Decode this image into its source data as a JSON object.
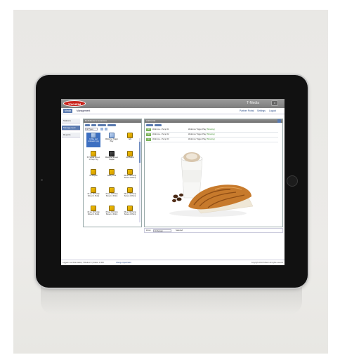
{
  "app": {
    "logo_text": "TOKHEIM",
    "title": "T-Media",
    "header_button": "×"
  },
  "nav": {
    "tabs": [
      "Media",
      "Management"
    ],
    "right_links": [
      "Partner Portal",
      "Settings",
      "Logout"
    ]
  },
  "left_menu": {
    "items": [
      "Stations",
      "Management",
      "Reports"
    ]
  },
  "library_panel": {
    "title": "Definitions & resources",
    "filter_label": "All Types",
    "tiles": [
      {
        "label": "Coffee and croissant 1.jpg",
        "icon": "image-icon",
        "style": "blue"
      },
      {
        "label": "Welcome Trigger Play",
        "icon": "image-icon",
        "style": "blue"
      },
      {
        "label": "Ads",
        "icon": "folder-icon",
        "style": "yellow"
      },
      {
        "label": "P1 Signal Screen 1 Pump Trig",
        "icon": "folder-icon",
        "style": "yellow"
      },
      {
        "label": "Welcome Screen Playlist",
        "icon": "film-icon",
        "style": "dark"
      },
      {
        "label": "Ad Playlist",
        "icon": "folder-icon",
        "style": "yellow"
      },
      {
        "label": "Oil Playlist",
        "icon": "folder-icon",
        "style": "yellow"
      },
      {
        "label": "Safety Lock",
        "icon": "folder-icon",
        "style": "yellow"
      },
      {
        "label": "30 sec 30 Pump Screen 1 Pump",
        "icon": "folder-icon",
        "style": "yellow"
      },
      {
        "label": "31 sec 30 Pump Screen 1 Pump",
        "icon": "folder-icon",
        "style": "yellow"
      },
      {
        "label": "32 sec 30 Pump Screen 1 Pump",
        "icon": "folder-icon",
        "style": "yellow"
      },
      {
        "label": "33 sec 30 Pump Screen 1 Pump",
        "icon": "folder-icon",
        "style": "yellow"
      },
      {
        "label": "34 sec 30 Pump Screen 1 Pump",
        "icon": "folder-icon",
        "style": "yellow"
      },
      {
        "label": "35 sec 30 Pump Screen 1 Pump",
        "icon": "folder-icon",
        "style": "yellow"
      },
      {
        "label": "36 sec 30 Pump Screen 1 Pump",
        "icon": "folder-icon",
        "style": "yellow"
      }
    ]
  },
  "assign_panel": {
    "title": "Add to list",
    "rows": [
      {
        "status": "OK",
        "name": "Welcome - Pump 01",
        "trigger": "Welcome Trigger Play",
        "state": "(Showing)"
      },
      {
        "status": "OK",
        "name": "Welcome - Pump 02",
        "trigger": "Welcome Trigger Play",
        "state": "(Showing)"
      },
      {
        "status": "OK",
        "name": "Welcome - Pump 03",
        "trigger": "Welcome Trigger Play",
        "state": "(Showing)"
      }
    ],
    "bottom_label": "Zoom",
    "bottom_select": "Fit Screen",
    "bottom_right": "Selected"
  },
  "footer": {
    "left": "Logged in as Wide Media | T-Media 2.0 | Station 13 Mid",
    "link": "Change organization",
    "right": "Copyright 2011 Tokheim All rights reserved"
  },
  "colors": {
    "accent": "#5a7ab0",
    "brand_red": "#c8241d",
    "ok_green": "#7bb35a"
  }
}
